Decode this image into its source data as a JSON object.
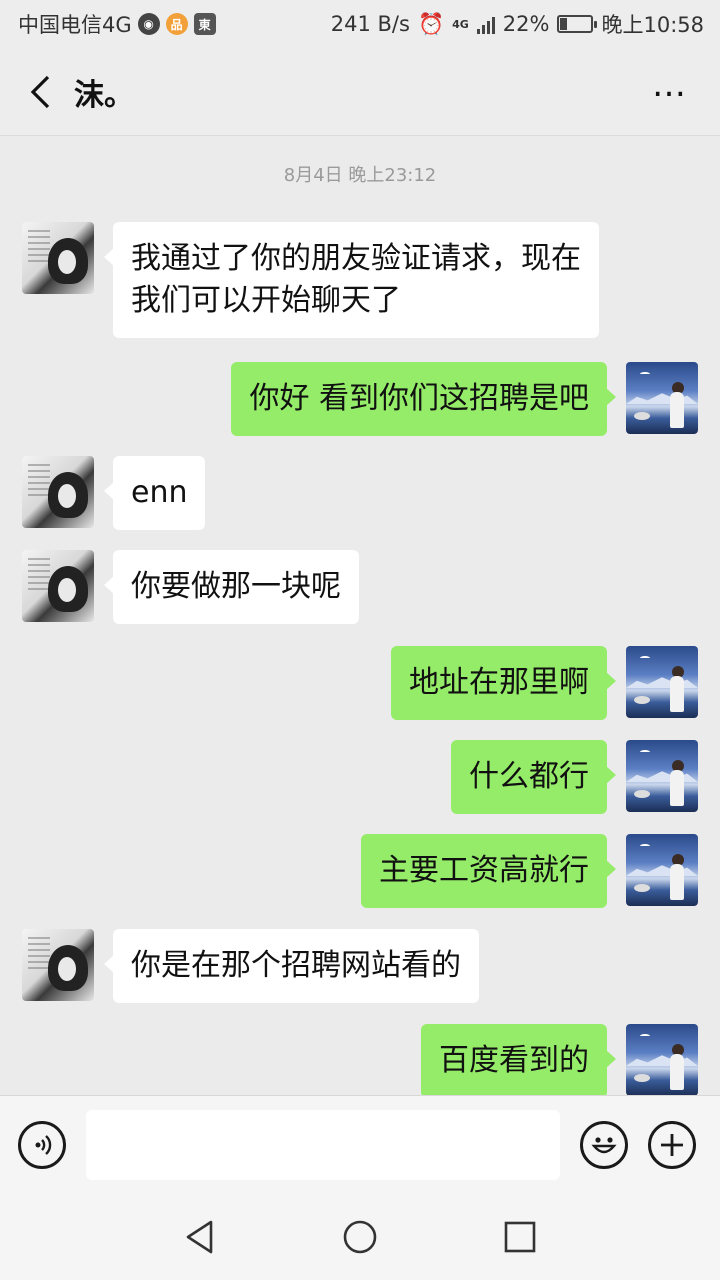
{
  "status_bar": {
    "carrier": "中国电信4G",
    "speed": "241 B/s",
    "network": "4G",
    "battery": "22%",
    "battery_level": 0.22,
    "time": "晚上10:58"
  },
  "header": {
    "title": "沫。",
    "back_icon": "chevron-left-icon",
    "more_label": "…"
  },
  "chat": {
    "timestamp": "8月4日 晚上23:12",
    "messages": [
      {
        "side": "left",
        "text": "我通过了你的朋友验证请求，现在\n我们可以开始聊天了"
      },
      {
        "side": "right",
        "text": "你好 看到你们这招聘是吧"
      },
      {
        "side": "left",
        "text": "enn"
      },
      {
        "side": "left",
        "text": "你要做那一块呢"
      },
      {
        "side": "right",
        "text": "地址在那里啊"
      },
      {
        "side": "right",
        "text": "什么都行"
      },
      {
        "side": "right",
        "text": "主要工资高就行"
      },
      {
        "side": "left",
        "text": "你是在那个招聘网站看的"
      },
      {
        "side": "right",
        "text": "百度看到的"
      }
    ]
  },
  "input_bar": {
    "voice_icon": "voice-icon",
    "input_value": "",
    "emoji_icon": "emoji-icon",
    "plus_icon": "plus-icon"
  },
  "nav_bar": {
    "back_icon": "triangle-back-icon",
    "home_icon": "circle-home-icon",
    "recent_icon": "square-recent-icon"
  },
  "colors": {
    "background": "#ebebeb",
    "sent_bubble": "#95ec69",
    "received_bubble": "#ffffff"
  }
}
